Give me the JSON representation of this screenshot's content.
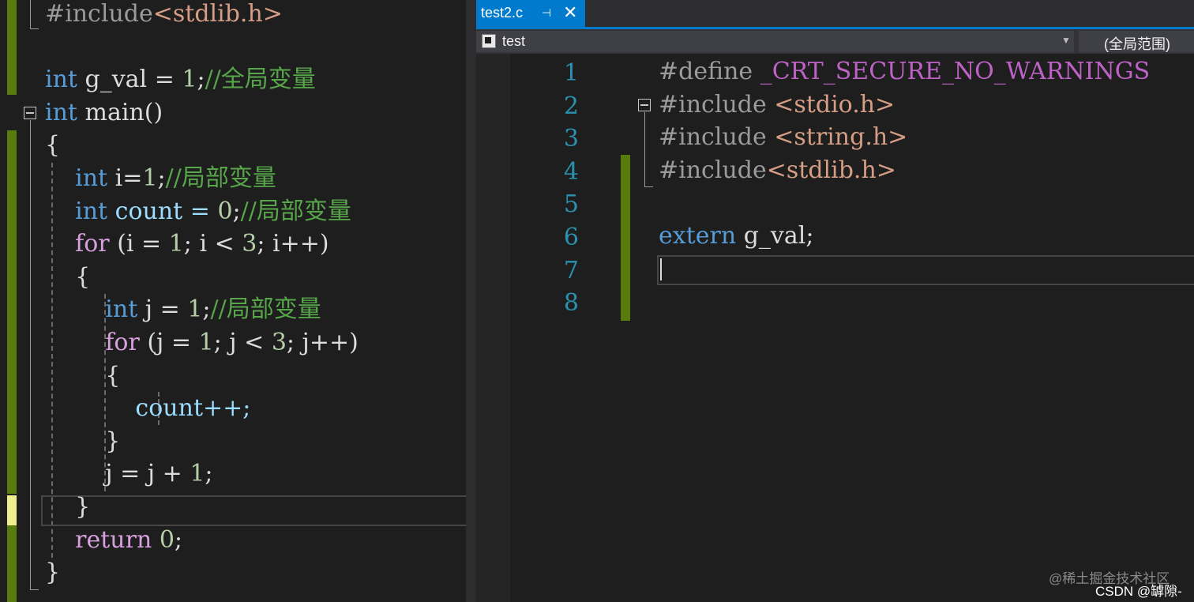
{
  "left_editor": {
    "lines": [
      [
        {
          "t": "#include",
          "c": "pp"
        },
        {
          "t": "<stdlib.h>",
          "c": "str"
        }
      ],
      [],
      [
        {
          "t": "int",
          "c": "kw"
        },
        {
          "t": " g_val = ",
          "c": "plain"
        },
        {
          "t": "1",
          "c": "num"
        },
        {
          "t": ";",
          "c": "plain"
        },
        {
          "t": "//全局变量",
          "c": "cmt"
        }
      ],
      [
        {
          "t": "int",
          "c": "kw"
        },
        {
          "t": " main()",
          "c": "plain"
        }
      ],
      [
        {
          "t": "{",
          "c": "plain"
        }
      ],
      [
        {
          "t": "    int",
          "c": "kw"
        },
        {
          "t": " i=",
          "c": "plain"
        },
        {
          "t": "1",
          "c": "num"
        },
        {
          "t": ";",
          "c": "plain"
        },
        {
          "t": "//局部变量",
          "c": "cmt"
        }
      ],
      [
        {
          "t": "    int",
          "c": "kw"
        },
        {
          "t": " count = ",
          "c": "id"
        },
        {
          "t": "0",
          "c": "num"
        },
        {
          "t": ";",
          "c": "plain"
        },
        {
          "t": "//局部变量",
          "c": "cmt"
        }
      ],
      [
        {
          "t": "    for",
          "c": "ctl"
        },
        {
          "t": " (i = ",
          "c": "plain"
        },
        {
          "t": "1",
          "c": "num"
        },
        {
          "t": "; i < ",
          "c": "plain"
        },
        {
          "t": "3",
          "c": "num"
        },
        {
          "t": "; i++)",
          "c": "plain"
        }
      ],
      [
        {
          "t": "    {",
          "c": "plain"
        }
      ],
      [
        {
          "t": "        int",
          "c": "kw"
        },
        {
          "t": " j = ",
          "c": "plain"
        },
        {
          "t": "1",
          "c": "num"
        },
        {
          "t": ";",
          "c": "plain"
        },
        {
          "t": "//局部变量",
          "c": "cmt"
        }
      ],
      [
        {
          "t": "        for",
          "c": "ctl"
        },
        {
          "t": " (j = ",
          "c": "plain"
        },
        {
          "t": "1",
          "c": "num"
        },
        {
          "t": "; j < ",
          "c": "plain"
        },
        {
          "t": "3",
          "c": "num"
        },
        {
          "t": "; j++)",
          "c": "plain"
        }
      ],
      [
        {
          "t": "        {",
          "c": "plain"
        }
      ],
      [
        {
          "t": "            count++;",
          "c": "id"
        }
      ],
      [
        {
          "t": "        }",
          "c": "plain"
        }
      ],
      [
        {
          "t": "        j = j + ",
          "c": "plain"
        },
        {
          "t": "1",
          "c": "num"
        },
        {
          "t": ";",
          "c": "plain"
        }
      ],
      [
        {
          "t": "    }",
          "c": "plain"
        }
      ],
      [
        {
          "t": "    return",
          "c": "ctl"
        },
        {
          "t": " ",
          "c": "plain"
        },
        {
          "t": "0",
          "c": "num"
        },
        {
          "t": ";",
          "c": "plain"
        }
      ],
      [
        {
          "t": "}",
          "c": "plain"
        }
      ]
    ]
  },
  "right_editor": {
    "tab": {
      "title": "test2.c",
      "pin_icon": "⊣",
      "close_icon": "✕"
    },
    "navbar": {
      "scope": "test",
      "member": "(全局范围)"
    },
    "line_numbers": [
      "1",
      "2",
      "3",
      "4",
      "5",
      "6",
      "7",
      "8"
    ],
    "lines": [
      [
        {
          "t": "#define",
          "c": "pp"
        },
        {
          "t": " _CRT_SECURE_NO_WARNINGS",
          "c": "mac"
        }
      ],
      [
        {
          "t": "#include",
          "c": "pp"
        },
        {
          "t": " <stdio.h>",
          "c": "str"
        }
      ],
      [
        {
          "t": "#include",
          "c": "pp"
        },
        {
          "t": " <string.h>",
          "c": "str"
        }
      ],
      [
        {
          "t": "#include",
          "c": "pp"
        },
        {
          "t": "<stdlib.h>",
          "c": "str"
        }
      ],
      [],
      [
        {
          "t": "extern",
          "c": "kw"
        },
        {
          "t": " g_val;",
          "c": "plain"
        }
      ],
      [],
      []
    ]
  },
  "watermark": {
    "line1": "@稀土掘金技术社区",
    "line2": "CSDN @罅隙-"
  }
}
